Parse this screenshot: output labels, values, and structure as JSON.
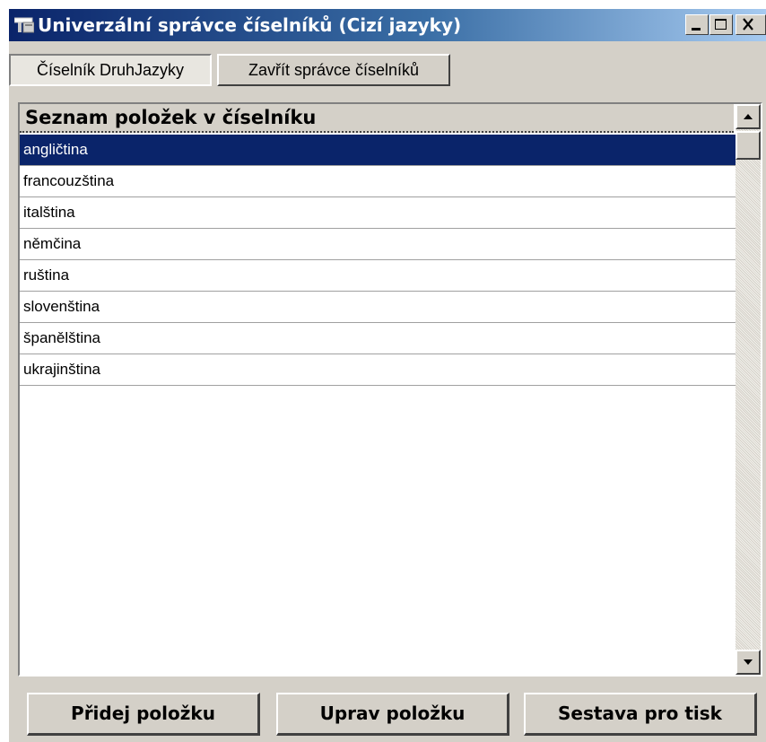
{
  "window": {
    "title": "Univerzální správce číselníků (Cizí jazyky)",
    "icon": "window-app-icon",
    "controls": [
      "minimize-icon",
      "maximize-icon",
      "close-icon"
    ]
  },
  "tabs": [
    {
      "label": "Číselník DruhJazyky",
      "active": true
    },
    {
      "label": "Zavřít správce číselníků",
      "active": false
    }
  ],
  "list": {
    "header": "Seznam položek v číselníku",
    "items": [
      {
        "label": "angličtina",
        "selected": true
      },
      {
        "label": "francouzština",
        "selected": false
      },
      {
        "label": "italština",
        "selected": false
      },
      {
        "label": "němčina",
        "selected": false
      },
      {
        "label": "ruština",
        "selected": false
      },
      {
        "label": "slovenština",
        "selected": false
      },
      {
        "label": "španělština",
        "selected": false
      },
      {
        "label": "ukrajinština",
        "selected": false
      }
    ]
  },
  "buttons": {
    "add": "Přidej položku",
    "edit": "Uprav položku",
    "report": "Sestava pro tisk"
  },
  "colors": {
    "title_bar": "#0a246a",
    "selection": "#0a246a",
    "face": "#d4d0c8"
  }
}
